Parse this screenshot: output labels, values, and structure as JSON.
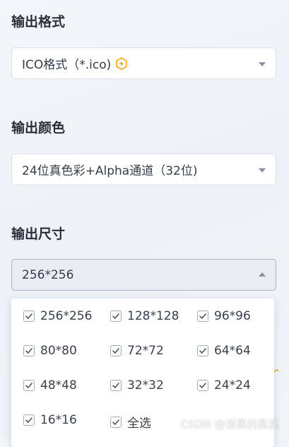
{
  "output_format": {
    "label": "输出格式",
    "value": "ICO格式（*.ico)",
    "badge_icon": "vip-lightning-icon",
    "badge_color": "#f5a623"
  },
  "output_color": {
    "label": "输出颜色",
    "value": "24位真色彩+Alpha通道（32位)"
  },
  "output_size": {
    "label": "输出尺寸",
    "value": "256*256",
    "options": [
      {
        "label": "256*256",
        "checked": true
      },
      {
        "label": "128*128",
        "checked": true
      },
      {
        "label": "96*96",
        "checked": true
      },
      {
        "label": "80*80",
        "checked": true
      },
      {
        "label": "72*72",
        "checked": true
      },
      {
        "label": "64*64",
        "checked": true
      },
      {
        "label": "48*48",
        "checked": true
      },
      {
        "label": "32*32",
        "checked": true
      },
      {
        "label": "24*24",
        "checked": true
      },
      {
        "label": "16*16",
        "checked": true
      },
      {
        "label": "全选",
        "checked": true
      }
    ]
  },
  "watermark": "CSDN @漆黑的莫莫",
  "colors": {
    "accent": "#f5a623",
    "checkbox_border": "#a4abb8",
    "check_mark": "#4a5263"
  }
}
